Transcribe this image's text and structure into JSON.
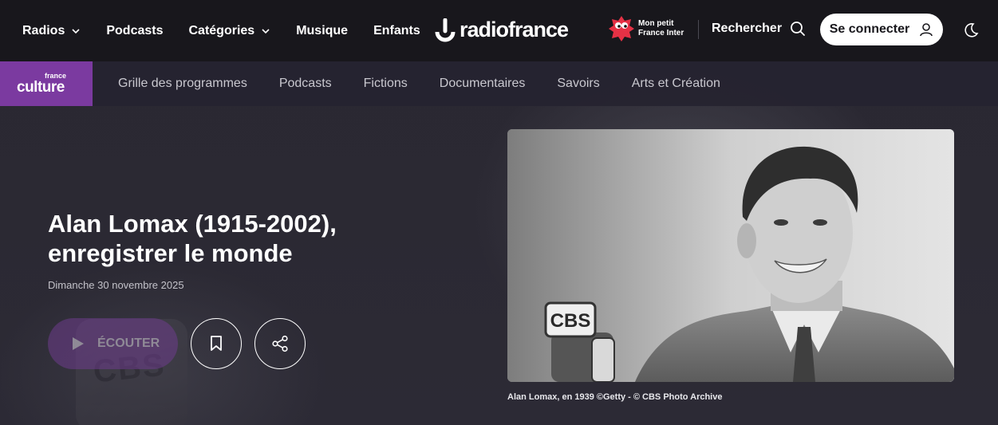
{
  "topnav": {
    "items": [
      {
        "label": "Radios",
        "dropdown": true
      },
      {
        "label": "Podcasts",
        "dropdown": false
      },
      {
        "label": "Catégories",
        "dropdown": true
      },
      {
        "label": "Musique",
        "dropdown": false
      },
      {
        "label": "Enfants",
        "dropdown": false
      }
    ],
    "brand": "radiofrance",
    "mon_petit_line1": "Mon petit",
    "mon_petit_line2": "France Inter",
    "search_label": "Rechercher",
    "login_label": "Se connecter"
  },
  "station": {
    "logo_small": "france",
    "logo_big": "culture",
    "color": "#7b3aa0",
    "subnav": [
      "Grille des programmes",
      "Podcasts",
      "Fictions",
      "Documentaires",
      "Savoirs",
      "Arts et Création"
    ]
  },
  "hero": {
    "title_line1": "Alan Lomax (1915-2002),",
    "title_line2": "enregistrer le monde",
    "date": "Dimanche 30 novembre 2025",
    "listen_label": "ÉCOUTER",
    "photo_caption": "Alan Lomax, en 1939 ©Getty - © CBS Photo Archive",
    "photo_mic_text": "CBS"
  },
  "icons": {
    "chevron": "chevron-down-icon",
    "search": "search-icon",
    "user": "user-icon",
    "theme": "moon-icon",
    "play": "play-icon",
    "bookmark": "bookmark-icon",
    "share": "share-icon"
  }
}
